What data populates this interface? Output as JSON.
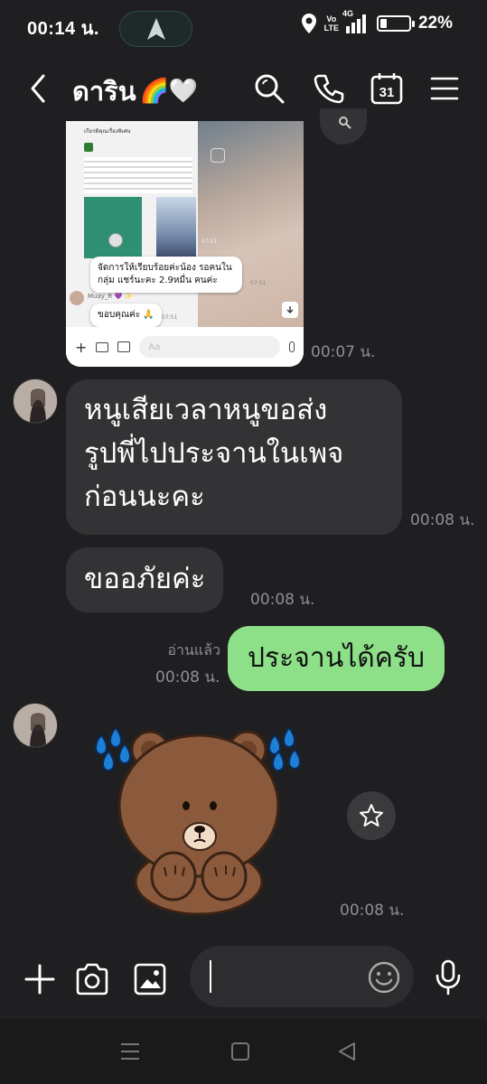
{
  "status_bar": {
    "time": "00:14 น.",
    "network_label": "Vo\nLTE",
    "signal_label": "4G",
    "battery_percent": "22%",
    "battery_level": 0.22
  },
  "header": {
    "contact_name": "ดาริน",
    "name_emoji": "🌈🤍",
    "calendar_day": "31"
  },
  "image_message": {
    "screenshot_header": "เกียรติคุณเรื่องพิเศษ",
    "caption_1": "จัดการให้เรียบร้อยค่ะน้อง รอคนในกลุ่ม แชร์นะคะ 2.9หมื่น คนค่ะ",
    "caption_2": "ขอบคุณค่ะ 🙏",
    "sender_label": "Muay_R 💜 ✨",
    "inner_time_1": "07:51",
    "inner_time_2": "07:51",
    "inner_time_3": "07:51",
    "field_placeholder": "Aa",
    "time": "00:07 น."
  },
  "messages": [
    {
      "direction": "in",
      "text_lines": [
        "หนูเสียเวลาหนูขอส่ง",
        "รูปพี่ไปประจานในเพจ",
        "ก่อนนะคะ"
      ],
      "time": "00:08 น."
    },
    {
      "direction": "in",
      "text": "ขออภัยค่ะ",
      "time": "00:08 น."
    },
    {
      "direction": "out",
      "text": "ประจานได้ครับ",
      "read_label": "อ่านแล้ว",
      "time": "00:08 น."
    }
  ],
  "sticker_message": {
    "sticker_name": "brown-bear-crying-sticker",
    "time": "00:08 น."
  },
  "input_bar": {
    "value": "",
    "icons": [
      "plus-icon",
      "camera-icon",
      "image-icon",
      "emoji-icon",
      "microphone-icon"
    ]
  },
  "colors": {
    "background": "#1f1f21",
    "incoming_bubble": "#333336",
    "outgoing_bubble": "#8de088",
    "timestamp": "#8f8f93"
  }
}
